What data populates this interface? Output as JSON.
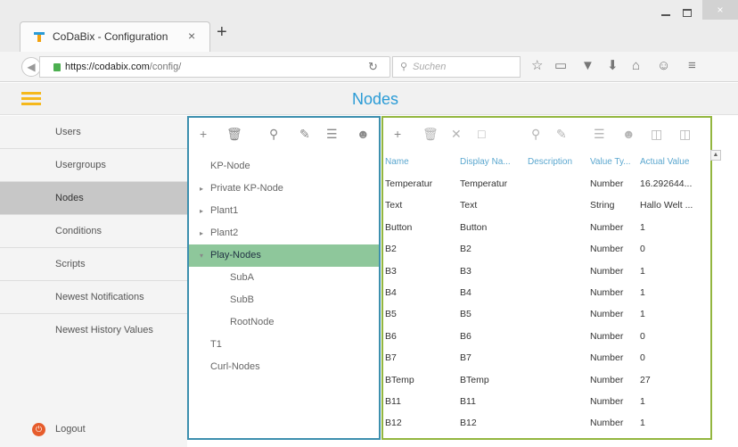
{
  "browser": {
    "tab_title": "CoDaBix - Configuration",
    "tab_close": "×",
    "new_tab": "+",
    "url_host": "https://codabix.com",
    "url_path": "/config/",
    "search_placeholder": "Suchen",
    "window_close": "×"
  },
  "app": {
    "page_title": "Nodes",
    "accent": "#2a9bd6",
    "menu_accent": "#f5b81c"
  },
  "sidebar": {
    "items": [
      {
        "label": "Users"
      },
      {
        "label": "Usergroups"
      },
      {
        "label": "Nodes",
        "active": true
      },
      {
        "label": "Conditions"
      },
      {
        "label": "Scripts"
      },
      {
        "label": "Newest Notifications"
      },
      {
        "label": "Newest History Values"
      }
    ],
    "logout_label": "Logout"
  },
  "tree": {
    "toolbar": [
      "add-icon",
      "delete-icon",
      "search-icon",
      "edit-icon",
      "tree-filter-icon",
      "users-icon"
    ],
    "items": [
      {
        "label": "KP-Node",
        "expander": "",
        "level": 0
      },
      {
        "label": "Private KP-Node",
        "expander": "▸",
        "level": 0
      },
      {
        "label": "Plant1",
        "expander": "▸",
        "level": 0
      },
      {
        "label": "Plant2",
        "expander": "▸",
        "level": 0
      },
      {
        "label": "Play-Nodes",
        "expander": "▾",
        "level": 0,
        "selected": true
      },
      {
        "label": "SubA",
        "expander": "",
        "level": 1
      },
      {
        "label": "SubB",
        "expander": "",
        "level": 1
      },
      {
        "label": "RootNode",
        "expander": "",
        "level": 1
      },
      {
        "label": "T1",
        "expander": "",
        "level": 0
      },
      {
        "label": "Curl-Nodes",
        "expander": "",
        "level": 0
      }
    ],
    "border_color": "#3c8fae",
    "selected_color": "#8ec79b"
  },
  "grid": {
    "toolbar": [
      "add-icon",
      "delete-icon",
      "cancel-icon",
      "save-icon",
      "search-icon",
      "edit-icon",
      "tree-filter-icon",
      "users-icon",
      "copy-icon",
      "paste-icon"
    ],
    "columns": [
      "Name",
      "Display Na...",
      "Description",
      "Value Ty...",
      "Actual Value"
    ],
    "rows": [
      [
        "Temperatur",
        "Temperatur",
        "",
        "Number",
        "16.292644..."
      ],
      [
        "Text",
        "Text",
        "",
        "String",
        "Hallo Welt ..."
      ],
      [
        "Button",
        "Button",
        "",
        "Number",
        "1"
      ],
      [
        "B2",
        "B2",
        "",
        "Number",
        "0"
      ],
      [
        "B3",
        "B3",
        "",
        "Number",
        "1"
      ],
      [
        "B4",
        "B4",
        "",
        "Number",
        "1"
      ],
      [
        "B5",
        "B5",
        "",
        "Number",
        "1"
      ],
      [
        "B6",
        "B6",
        "",
        "Number",
        "0"
      ],
      [
        "B7",
        "B7",
        "",
        "Number",
        "0"
      ],
      [
        "BTemp",
        "BTemp",
        "",
        "Number",
        "27"
      ],
      [
        "B11",
        "B11",
        "",
        "Number",
        "1"
      ],
      [
        "B12",
        "B12",
        "",
        "Number",
        "1"
      ]
    ],
    "border_color": "#93b63f"
  }
}
